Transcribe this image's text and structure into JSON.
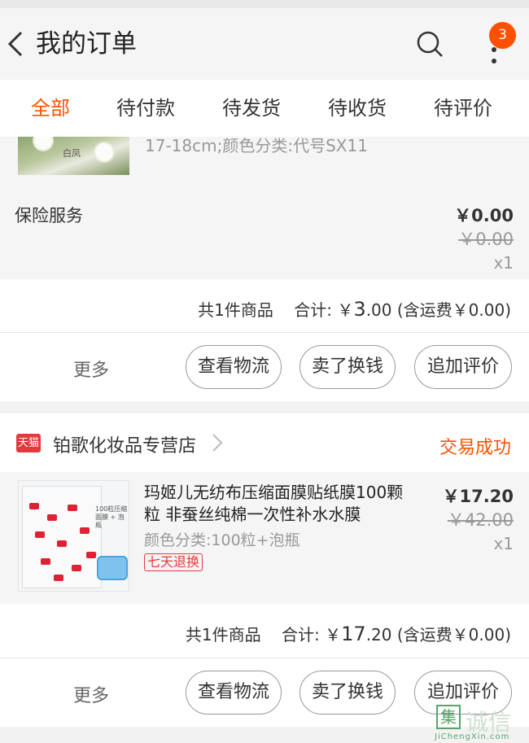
{
  "header": {
    "title": "我的订单",
    "notification_count": "3"
  },
  "tabs": [
    {
      "label": "全部",
      "active": true
    },
    {
      "label": "待付款"
    },
    {
      "label": "待发货"
    },
    {
      "label": "待收货"
    },
    {
      "label": "待评价"
    }
  ],
  "order1": {
    "product_spec_partial": "17-18cm;颜色分类:代号SX11",
    "thumb_tag": "白凤",
    "insurance": {
      "label": "保险服务",
      "price": "￥0.00",
      "original_price": "￥0.00",
      "quantity": "x1"
    },
    "summary": {
      "count_text": "共1件商品",
      "total_label": "合计: ￥",
      "total_big": "3",
      "total_small": ".00",
      "shipping_note": "(含运费￥0.00)"
    },
    "actions": {
      "more": "更多",
      "logistics": "查看物流",
      "resell": "卖了换钱",
      "review": "追加评价"
    }
  },
  "order2": {
    "shop_badge": "天猫",
    "shop_name": "铂歌化妆品专营店",
    "status": "交易成功",
    "product": {
      "title": "玛姬儿无纺布压缩面膜贴纸膜100颗粒 非蚕丝纯棉一次性补水水膜",
      "spec": "颜色分类:100粒+泡瓶",
      "return_policy": "七天退换",
      "price": "￥17.20",
      "original_price": "￥42.00",
      "quantity": "x1",
      "thumb_text": "100粒压缩面膜 + 泡瓶"
    },
    "summary": {
      "count_text": "共1件商品",
      "total_label": "合计: ￥",
      "total_big": "17",
      "total_small": ".20",
      "shipping_note": "(含运费￥0.00)"
    },
    "actions": {
      "more": "更多",
      "logistics": "查看物流",
      "resell": "卖了换钱",
      "review": "追加评价"
    }
  },
  "watermark": {
    "mark": "集",
    "text": "诚信",
    "url": "JiChengXin.com"
  },
  "colors": {
    "accent": "#ff5000",
    "tmall_red": "#e4393c"
  }
}
